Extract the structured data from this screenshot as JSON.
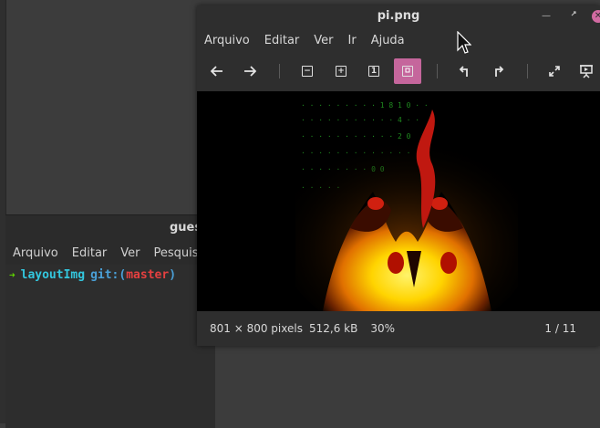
{
  "terminal": {
    "title": "gues",
    "menu": [
      "Arquivo",
      "Editar",
      "Ver",
      "Pesquisar"
    ],
    "prompt": {
      "cwd": "layoutImg",
      "git_label": "git:(",
      "branch": "master",
      "git_close": ")"
    }
  },
  "viewer": {
    "title": "pi.png",
    "menu": [
      "Arquivo",
      "Editar",
      "Ver",
      "Ir",
      "Ajuda"
    ],
    "toolbar": {
      "zoom_out": "zoom-out-icon",
      "zoom_in": "zoom-in-icon",
      "normal_size": "1",
      "best_fit_active": true
    },
    "status": {
      "dimensions": "801 × 800 pixels",
      "file_size": "512,6 kB",
      "zoom": "30%",
      "page": "1 / 11"
    }
  },
  "colors": {
    "accent": "#c5669c",
    "terminal_arrow": "#5fd700",
    "terminal_cwd": "#33c7de",
    "terminal_branch": "#e54040"
  }
}
